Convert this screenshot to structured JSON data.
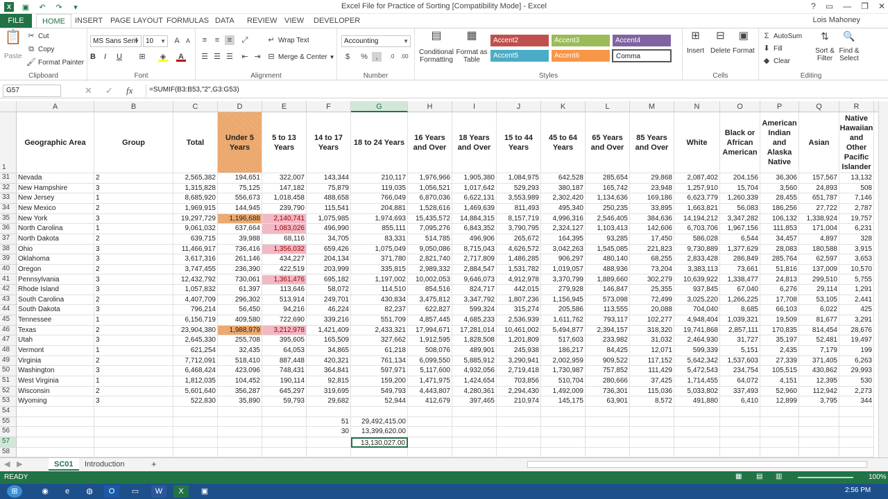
{
  "titlebar": {
    "title": "Excel File for Practice of Sorting  [Compatibility Mode] - Excel",
    "help": "?",
    "min": "—",
    "restore": "❐",
    "close": "✕"
  },
  "tabs": {
    "file": "FILE",
    "items": [
      "HOME",
      "INSERT",
      "PAGE LAYOUT",
      "FORMULAS",
      "DATA",
      "REVIEW",
      "VIEW",
      "DEVELOPER"
    ],
    "user": "Lois Mahoney"
  },
  "ribbon": {
    "clipboard": {
      "paste": "Paste",
      "cut": "Cut",
      "copy": "Copy",
      "format_painter": "Format Painter",
      "label": "Clipboard"
    },
    "font": {
      "name": "MS Sans Serif",
      "size": "10",
      "label": "Font",
      "bold": "B",
      "italic": "I",
      "underline": "U"
    },
    "alignment": {
      "wrap": "Wrap Text",
      "merge": "Merge & Center",
      "label": "Alignment"
    },
    "number": {
      "format": "Accounting",
      "label": "Number"
    },
    "styles": {
      "cond": "Conditional Formatting",
      "table": "Format as Table",
      "label": "Styles",
      "cells": [
        {
          "t": "Accent2",
          "c": "#c0504d"
        },
        {
          "t": "Accent3",
          "c": "#9bbb59"
        },
        {
          "t": "Accent4",
          "c": "#8064a2"
        },
        {
          "t": "Accent5",
          "c": "#4bacc6"
        },
        {
          "t": "Accent6",
          "c": "#f79646"
        },
        {
          "t": "Comma",
          "c": "#ffffff"
        }
      ]
    },
    "cells": {
      "insert": "Insert",
      "delete": "Delete",
      "format": "Format",
      "label": "Cells"
    },
    "editing": {
      "autosum": "AutoSum",
      "fill": "Fill",
      "clear": "Clear",
      "sort": "Sort & Filter",
      "find": "Find & Select",
      "label": "Editing"
    }
  },
  "formula_bar": {
    "namebox": "G57",
    "formula": "=SUMIF(B3:B53,\"2\",G3:G53)"
  },
  "columns": [
    "A",
    "B",
    "C",
    "D",
    "E",
    "F",
    "G",
    "H",
    "I",
    "J",
    "K",
    "L",
    "M",
    "N",
    "O",
    "P",
    "Q",
    "R"
  ],
  "headers": [
    "Geographic Area",
    "Group",
    "Total",
    "Under 5 Years",
    "5 to 13 Years",
    "14 to 17 Years",
    "18 to 24 Years",
    "16 Years and Over",
    "18 Years and Over",
    "15 to 44 Years",
    "45 to 64 Years",
    "65 Years and Over",
    "85 Years and Over",
    "White",
    "Black or African American",
    "American Indian and Alaska Native",
    "Asian",
    "Native Hawaiian and Other Pacific Islander"
  ],
  "rows": [
    {
      "r": "31",
      "v": [
        "Nevada",
        "2",
        "2,565,382",
        "194,651",
        "322,007",
        "143,344",
        "210,117",
        "1,976,966",
        "1,905,380",
        "1,084,975",
        "642,528",
        "285,654",
        "29,868",
        "2,087,402",
        "204,156",
        "36,306",
        "157,567",
        "13,132"
      ]
    },
    {
      "r": "32",
      "v": [
        "New Hampshire",
        "3",
        "1,315,828",
        "75,125",
        "147,182",
        "75,879",
        "119,035",
        "1,056,521",
        "1,017,642",
        "529,293",
        "380,187",
        "165,742",
        "23,948",
        "1,257,910",
        "15,704",
        "3,560",
        "24,893",
        "508"
      ]
    },
    {
      "r": "33",
      "v": [
        "New Jersey",
        "1",
        "8,685,920",
        "556,673",
        "1,018,458",
        "488,658",
        "766,049",
        "6,870,036",
        "6,622,131",
        "3,553,989",
        "2,302,420",
        "1,134,636",
        "169,186",
        "6,623,779",
        "1,260,339",
        "28,455",
        "651,787",
        "7,146"
      ]
    },
    {
      "r": "34",
      "v": [
        "New Mexico",
        "2",
        "1,969,915",
        "144,945",
        "239,790",
        "115,541",
        "204,881",
        "1,528,616",
        "1,469,639",
        "811,493",
        "495,340",
        "250,235",
        "33,895",
        "1,663,821",
        "56,083",
        "186,256",
        "27,722",
        "2,787"
      ]
    },
    {
      "r": "35",
      "v": [
        "New York",
        "3",
        "19,297,729",
        "1,196,688",
        "2,140,741",
        "1,075,985",
        "1,974,693",
        "15,435,572",
        "14,884,315",
        "8,157,719",
        "4,996,316",
        "2,546,405",
        "384,636",
        "14,194,212",
        "3,347,282",
        "106,132",
        "1,338,924",
        "19,757"
      ]
    },
    {
      "r": "36",
      "v": [
        "North Carolina",
        "1",
        "9,061,032",
        "637,664",
        "1,083,026",
        "496,990",
        "855,111",
        "7,095,276",
        "6,843,352",
        "3,790,795",
        "2,324,127",
        "1,103,413",
        "142,606",
        "6,703,706",
        "1,967,156",
        "111,853",
        "171,004",
        "6,231"
      ]
    },
    {
      "r": "37",
      "v": [
        "North Dakota",
        "2",
        "639,715",
        "39,988",
        "68,116",
        "34,705",
        "83,331",
        "514,785",
        "496,906",
        "265,672",
        "164,395",
        "93,285",
        "17,450",
        "586,028",
        "6,544",
        "34,457",
        "4,897",
        "328"
      ]
    },
    {
      "r": "38",
      "v": [
        "Ohio",
        "3",
        "11,466,917",
        "736,416",
        "1,356,032",
        "659,426",
        "1,075,049",
        "9,050,086",
        "8,715,043",
        "4,626,572",
        "3,042,263",
        "1,545,085",
        "221,823",
        "9,730,889",
        "1,377,629",
        "28,083",
        "180,588",
        "3,915"
      ]
    },
    {
      "r": "39",
      "v": [
        "Oklahoma",
        "3",
        "3,617,316",
        "261,146",
        "434,227",
        "204,134",
        "371,780",
        "2,821,740",
        "2,717,809",
        "1,486,285",
        "906,297",
        "480,140",
        "68,255",
        "2,833,428",
        "286,849",
        "285,764",
        "62,597",
        "3,653"
      ]
    },
    {
      "r": "40",
      "v": [
        "Oregon",
        "2",
        "3,747,455",
        "236,390",
        "422,519",
        "203,999",
        "335,815",
        "2,989,332",
        "2,884,547",
        "1,531,782",
        "1,019,057",
        "488,936",
        "73,204",
        "3,383,113",
        "73,661",
        "51,816",
        "137,009",
        "10,570"
      ]
    },
    {
      "r": "41",
      "v": [
        "Pennsylvania",
        "3",
        "12,432,792",
        "730,061",
        "1,361,476",
        "695,182",
        "1,197,002",
        "10,002,053",
        "9,646,073",
        "4,912,978",
        "3,370,799",
        "1,889,660",
        "302,279",
        "10,639,922",
        "1,338,477",
        "24,813",
        "299,510",
        "5,755"
      ]
    },
    {
      "r": "42",
      "v": [
        "Rhode Island",
        "3",
        "1,057,832",
        "61,397",
        "113,646",
        "58,072",
        "114,510",
        "854,516",
        "824,717",
        "442,015",
        "279,928",
        "146,847",
        "25,355",
        "937,845",
        "67,040",
        "6,276",
        "29,114",
        "1,291"
      ]
    },
    {
      "r": "43",
      "v": [
        "South Carolina",
        "2",
        "4,407,709",
        "296,302",
        "513,914",
        "249,701",
        "430,834",
        "3,475,812",
        "3,347,792",
        "1,807,236",
        "1,156,945",
        "573,098",
        "72,499",
        "3,025,220",
        "1,266,225",
        "17,708",
        "53,105",
        "2,441"
      ]
    },
    {
      "r": "44",
      "v": [
        "South Dakota",
        "3",
        "796,214",
        "56,450",
        "94,216",
        "46,224",
        "82,237",
        "622,827",
        "599,324",
        "315,274",
        "205,586",
        "113,555",
        "20,088",
        "704,040",
        "8,685",
        "66,103",
        "6,022",
        "425"
      ]
    },
    {
      "r": "45",
      "v": [
        "Tennessee",
        "1",
        "6,156,719",
        "409,580",
        "722,690",
        "339,216",
        "551,709",
        "4,857,445",
        "4,685,233",
        "2,536,939",
        "1,611,762",
        "793,117",
        "102,277",
        "4,948,404",
        "1,039,321",
        "19,509",
        "81,677",
        "3,291"
      ]
    },
    {
      "r": "46",
      "v": [
        "Texas",
        "2",
        "23,904,380",
        "1,988,979",
        "3,212,978",
        "1,421,409",
        "2,433,321",
        "17,994,671",
        "17,281,014",
        "10,461,002",
        "5,494,877",
        "2,394,157",
        "318,320",
        "19,741,868",
        "2,857,111",
        "170,835",
        "814,454",
        "28,676"
      ]
    },
    {
      "r": "47",
      "v": [
        "Utah",
        "3",
        "2,645,330",
        "255,708",
        "395,605",
        "165,509",
        "327,662",
        "1,912,595",
        "1,828,508",
        "1,201,809",
        "517,603",
        "233,982",
        "31,032",
        "2,464,930",
        "31,727",
        "35,197",
        "52,481",
        "19,497"
      ]
    },
    {
      "r": "48",
      "v": [
        "Vermont",
        "1",
        "621,254",
        "32,435",
        "64,053",
        "34,865",
        "61,218",
        "508,076",
        "489,901",
        "245,938",
        "186,217",
        "84,425",
        "12,071",
        "599,339",
        "5,151",
        "2,435",
        "7,179",
        "199"
      ]
    },
    {
      "r": "49",
      "v": [
        "Virginia",
        "2",
        "7,712,091",
        "518,410",
        "887,448",
        "420,321",
        "761,134",
        "6,099,550",
        "5,885,912",
        "3,290,941",
        "2,002,959",
        "909,522",
        "117,152",
        "5,642,342",
        "1,537,603",
        "27,339",
        "371,405",
        "6,263"
      ]
    },
    {
      "r": "50",
      "v": [
        "Washington",
        "3",
        "6,468,424",
        "423,096",
        "748,431",
        "364,841",
        "597,971",
        "5,117,600",
        "4,932,056",
        "2,719,418",
        "1,730,987",
        "757,852",
        "111,429",
        "5,472,543",
        "234,754",
        "105,515",
        "430,862",
        "29,993"
      ]
    },
    {
      "r": "51",
      "v": [
        "West Virginia",
        "1",
        "1,812,035",
        "104,452",
        "190,114",
        "92,815",
        "159,200",
        "1,471,975",
        "1,424,654",
        "703,856",
        "510,704",
        "280,666",
        "37,425",
        "1,714,455",
        "64,072",
        "4,151",
        "12,395",
        "530"
      ]
    },
    {
      "r": "52",
      "v": [
        "Wisconsin",
        "2",
        "5,601,640",
        "356,287",
        "645,297",
        "319,695",
        "549,793",
        "4,443,807",
        "4,280,361",
        "2,294,430",
        "1,492,009",
        "736,301",
        "115,036",
        "5,033,802",
        "337,493",
        "52,960",
        "112,942",
        "2,273"
      ]
    },
    {
      "r": "53",
      "v": [
        "Wyoming",
        "3",
        "522,830",
        "35,890",
        "59,793",
        "29,682",
        "52,944",
        "412,679",
        "397,465",
        "210,974",
        "145,175",
        "63,901",
        "8,572",
        "491,880",
        "6,410",
        "12,899",
        "3,795",
        "344"
      ]
    }
  ],
  "extra_rows": [
    {
      "r": "54",
      "f": "",
      "g": ""
    },
    {
      "r": "55",
      "f": "51",
      "g": "29,492,415.00"
    },
    {
      "r": "56",
      "f": "30",
      "g": "13,399,620.00"
    },
    {
      "r": "57",
      "f": "",
      "g": "13,130,027.00"
    },
    {
      "r": "58",
      "f": "",
      "g": ""
    }
  ],
  "header_row": "1",
  "sheets": {
    "active": "SC01",
    "other": "Introduction",
    "add": "+"
  },
  "status": {
    "ready": "READY",
    "zoom": "100%"
  },
  "taskbar": {
    "time": "2:56 PM"
  }
}
